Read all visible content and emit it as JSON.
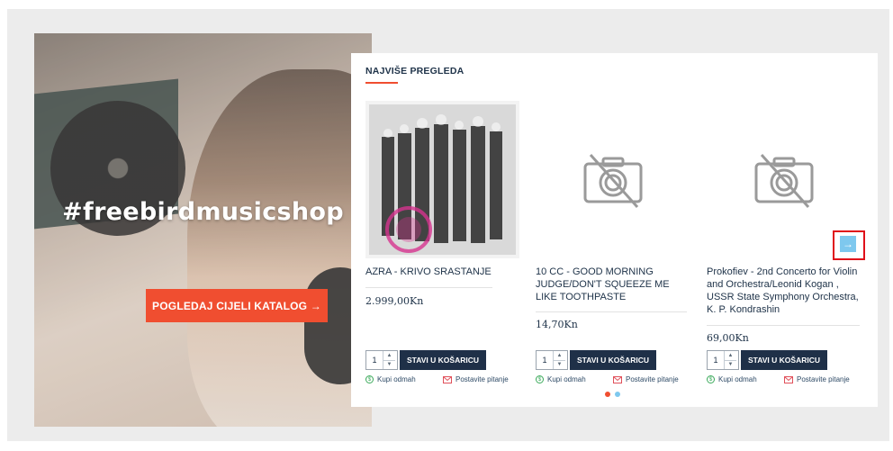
{
  "hero": {
    "hashtag": "#freebirdmusicshop",
    "cta_label": "POGLEDAJ CIJELI KATALOG →"
  },
  "section": {
    "title": "NAJVIŠE PREGLEDA"
  },
  "products": [
    {
      "title": "AZRA - KRIVO SRASTANJE",
      "price": "2.999,00Kn",
      "qty": "1",
      "add_label": "STAVI U KOŠARICU",
      "buy_now": "Kupi odmah",
      "ask": "Postavite pitanje",
      "image": "album-cover-photo"
    },
    {
      "title": "10 CC - GOOD MORNING JUDGE/DON'T SQUEEZE ME LIKE TOOTHPASTE",
      "price": "14,70Kn",
      "qty": "1",
      "add_label": "STAVI U KOŠARICU",
      "buy_now": "Kupi odmah",
      "ask": "Postavite pitanje",
      "image": "no-image-icon"
    },
    {
      "title": "Prokofiev - 2nd Concerto for Violin and Orchestra/Leonid Kogan , USSR State Symphony Orchestra, K. P. Kondrashin",
      "price": "69,00Kn",
      "qty": "1",
      "add_label": "STAVI U KOŠARICU",
      "buy_now": "Kupi odmah",
      "ask": "Postavite pitanje",
      "image": "no-image-icon"
    }
  ],
  "carousel": {
    "next_icon": "arrow-right-icon",
    "pages_total": 2,
    "active_page": 1
  },
  "colors": {
    "accent": "#f04e30",
    "navy": "#1f3048",
    "arrow_bg": "#7ec8ee",
    "dot_inactive": "#7ec8ee",
    "highlight": "#e0101a"
  }
}
